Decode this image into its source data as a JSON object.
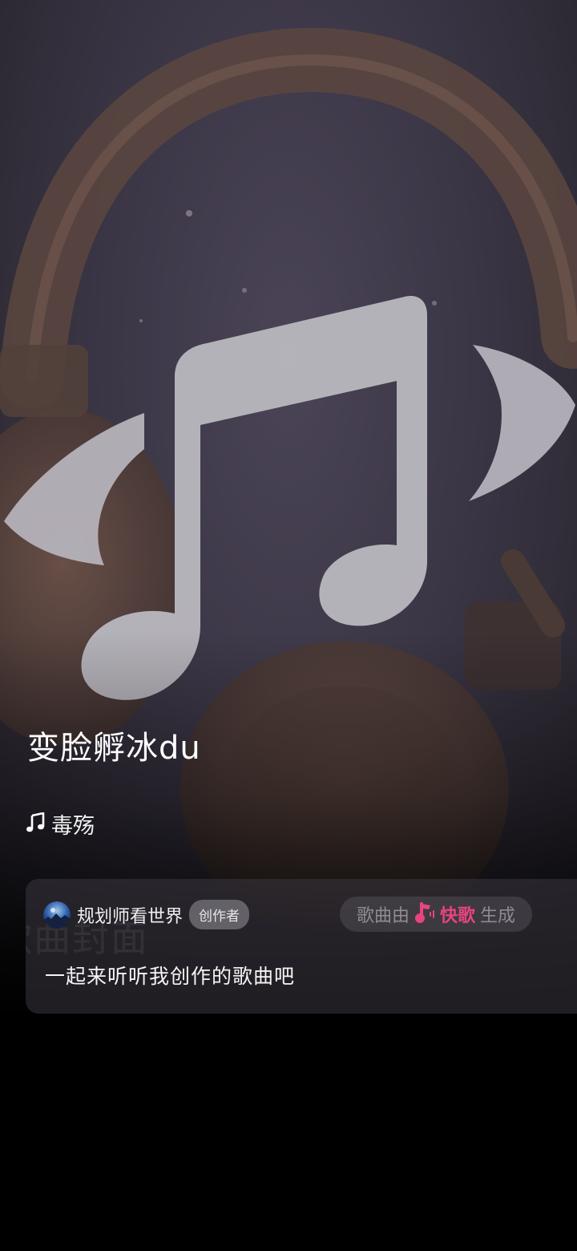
{
  "song": {
    "title": "变脸孵冰du",
    "meta_text": "毒殇"
  },
  "creator": {
    "name": "规划师看世界",
    "badge": "创作者",
    "caption": "一起来听听我创作的歌曲吧"
  },
  "brand": {
    "prefix": "歌曲由",
    "name": "快歌",
    "suffix": "生成"
  },
  "watermark": "歌曲封面",
  "icons": {
    "cover": "music-note-in-headphones",
    "meta": "music-note-icon",
    "avatar": "avatar",
    "brand": "kuaige-logo-icon"
  },
  "colors": {
    "brand_accent": "#e8447f",
    "background": "#000000"
  }
}
